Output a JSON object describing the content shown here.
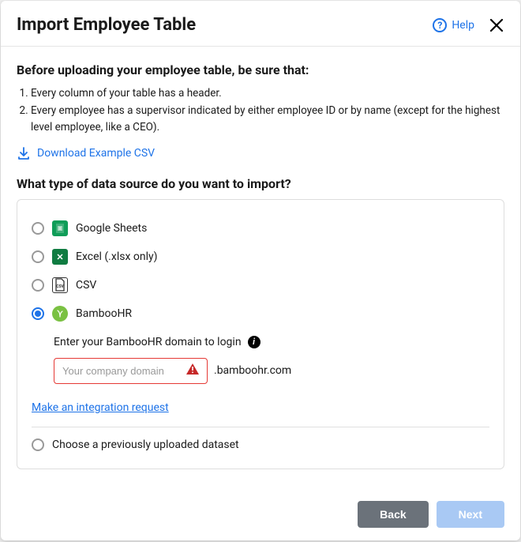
{
  "header": {
    "title": "Import Employee Table",
    "help_label": "Help"
  },
  "body": {
    "checklist_heading": "Before uploading your employee table, be sure that:",
    "checklist_items": [
      "Every column of your table has a header.",
      "Every employee has a supervisor indicated by either employee ID or by name (except for the highest level employee, like a CEO)."
    ],
    "download_label": "Download Example CSV",
    "source_question": "What type of data source do you want to import?",
    "sources": {
      "google_sheets": "Google Sheets",
      "excel": "Excel (.xlsx only)",
      "csv": "CSV",
      "bamboohr": "BambooHR"
    },
    "bamboo": {
      "prompt": "Enter your BambooHR domain to login",
      "placeholder": "Your company domain",
      "suffix": ".bamboohr.com"
    },
    "integration_link": "Make an integration request",
    "previous_dataset_label": "Choose a previously uploaded dataset"
  },
  "footer": {
    "back_label": "Back",
    "next_label": "Next"
  }
}
